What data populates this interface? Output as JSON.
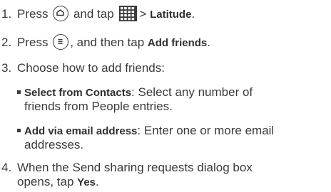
{
  "steps": [
    {
      "num": "1.",
      "pre": "Press",
      "mid": "and tap",
      "arrow": ">",
      "target": "Latitude",
      "end": ".",
      "icons": [
        "home-icon",
        "apps-grid-icon"
      ]
    },
    {
      "num": "2.",
      "pre": "Press",
      "mid": ", and then tap",
      "target": "Add friends",
      "end": ".",
      "icons": [
        "menu-icon"
      ]
    },
    {
      "num": "3.",
      "text": "Choose how to add friends:",
      "options": [
        {
          "label": "Select from Contacts",
          "line1": ": Select any number of",
          "line2": "friends from People entries."
        },
        {
          "label": "Add via email address",
          "line1": ": Enter one or more email",
          "line2": "addresses."
        }
      ]
    },
    {
      "num": "4.",
      "line1": "When the Send sharing requests dialog box",
      "line2_pre": "opens, tap",
      "target": "Yes",
      "end": "."
    }
  ],
  "colors": {
    "text": "#3a3a3a",
    "icon_grid": "#3a3a3a"
  }
}
